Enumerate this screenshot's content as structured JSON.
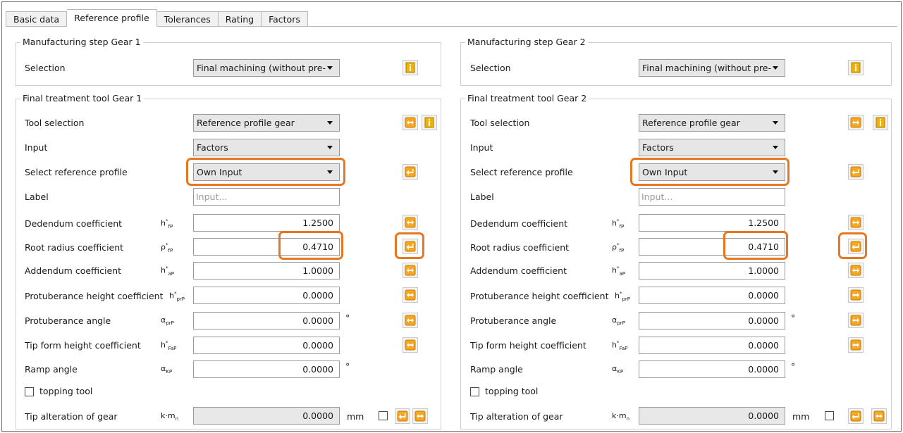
{
  "tabs": [
    "Basic data",
    "Reference profile",
    "Tolerances",
    "Rating",
    "Factors"
  ],
  "gear1": {
    "mfg_title": "Manufacturing step Gear 1",
    "selection_label": "Selection",
    "selection_value": "Final machining (without pre-",
    "tool_title": "Final treatment tool Gear 1",
    "tool_selection_label": "Tool selection",
    "tool_selection_value": "Reference profile gear",
    "input_label": "Input",
    "input_value": "Factors",
    "refprofile_label": "Select reference profile",
    "refprofile_value": "Own Input",
    "label_label": "Label",
    "label_placeholder": "Input...",
    "dedendum_label": "Dedendum coefficient",
    "dedendum_value": "1.2500",
    "rootradius_label": "Root radius coefficient",
    "rootradius_value": "0.4710",
    "addendum_label": "Addendum coefficient",
    "addendum_value": "1.0000",
    "protheight_label": "Protuberance height coefficient",
    "protheight_value": "0.0000",
    "protangle_label": "Protuberance angle",
    "protangle_value": "0.0000",
    "tipform_label": "Tip form height coefficient",
    "tipform_value": "0.0000",
    "ramp_label": "Ramp angle",
    "ramp_value": "0.0000",
    "topping_label": "topping tool",
    "tipalt_label": "Tip alteration of gear",
    "tipalt_value": "0.0000"
  },
  "gear2": {
    "mfg_title": "Manufacturing step Gear 2",
    "selection_label": "Selection",
    "selection_value": "Final machining (without pre-",
    "tool_title": "Final treatment tool Gear 2",
    "tool_selection_label": "Tool selection",
    "tool_selection_value": "Reference profile gear",
    "input_label": "Input",
    "input_value": "Factors",
    "refprofile_label": "Select reference profile",
    "refprofile_value": "Own Input",
    "label_label": "Label",
    "label_placeholder": "Input...",
    "dedendum_label": "Dedendum coefficient",
    "dedendum_value": "1.2500",
    "rootradius_label": "Root radius coefficient",
    "rootradius_value": "0.4710",
    "addendum_label": "Addendum coefficient",
    "addendum_value": "1.0000",
    "protheight_label": "Protuberance height coefficient",
    "protheight_value": "0.0000",
    "protangle_label": "Protuberance angle",
    "protangle_value": "0.0000",
    "tipform_label": "Tip form height coefficient",
    "tipform_value": "0.0000",
    "ramp_label": "Ramp angle",
    "ramp_value": "0.0000",
    "topping_label": "topping tool",
    "tipalt_label": "Tip alteration of gear",
    "tipalt_value": "0.0000"
  },
  "symbols": {
    "dedendum": "h*fP",
    "rootradius": "ρ*fP",
    "addendum": "h*aP",
    "protheight": "h*prP",
    "protangle": "αprP",
    "tipform": "h*FaP",
    "ramp": "αKP",
    "tipalt": "k·mn"
  },
  "units": {
    "degree": "°",
    "mm": "mm"
  },
  "colors": {
    "highlight": "#e87722",
    "button_orange": "#f5a623",
    "info_yellow": "#f0b400"
  }
}
